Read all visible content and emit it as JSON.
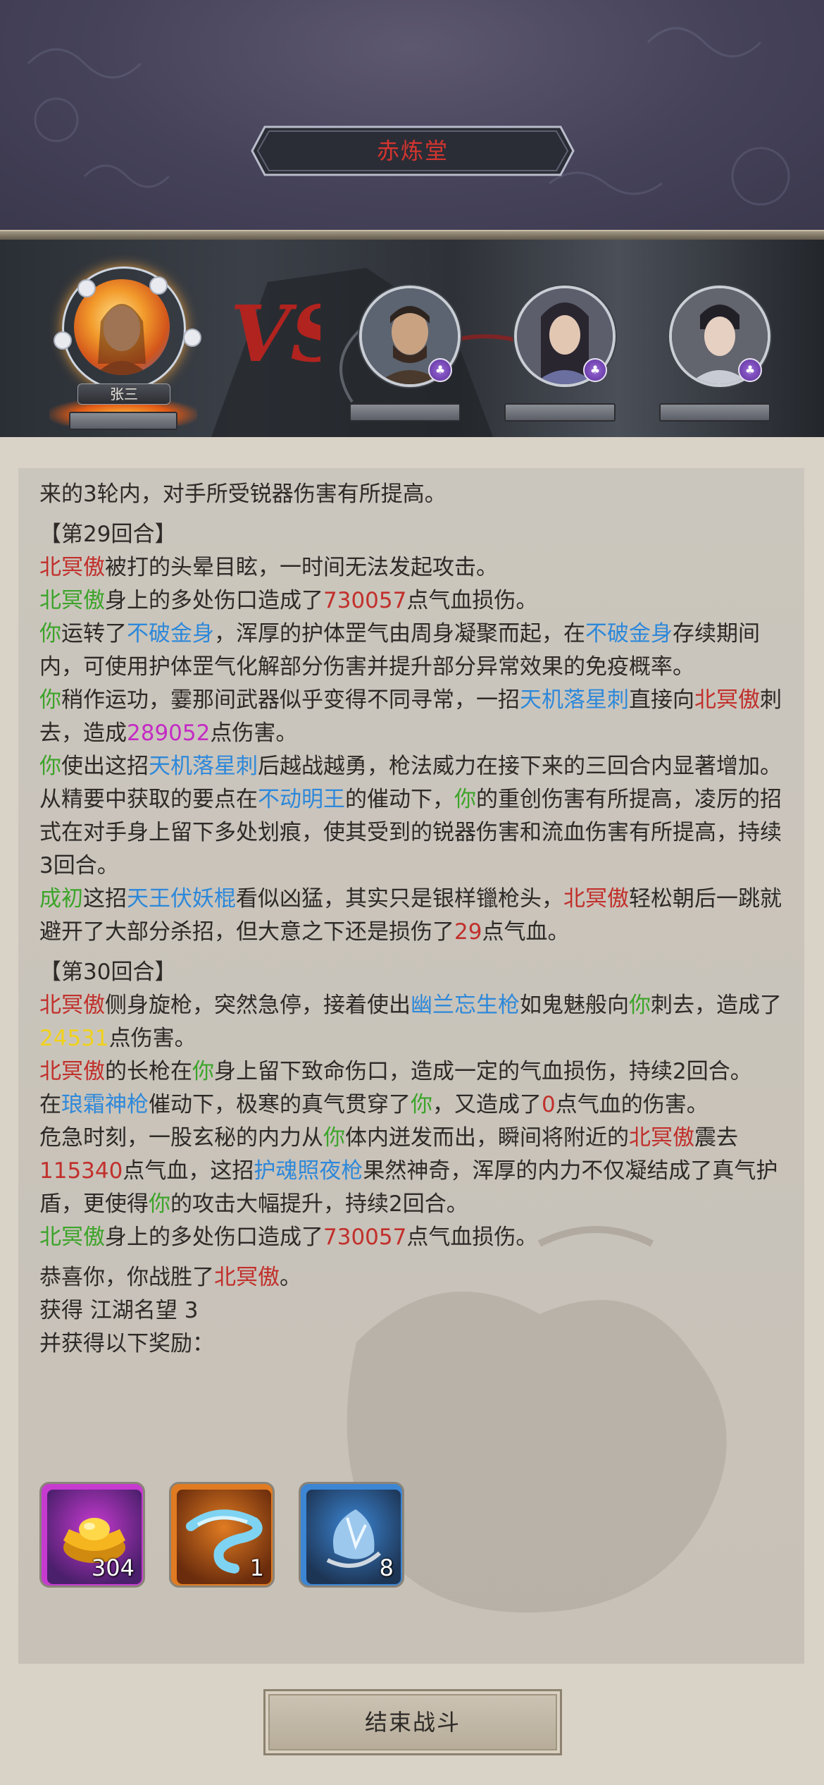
{
  "header": {
    "title": "赤炼堂"
  },
  "battle": {
    "player_name": "张三",
    "vs_label": "VS"
  },
  "colors": {
    "red": "#c1302c",
    "green": "#3ca42a",
    "blue": "#2d88da",
    "magenta": "#c42bc4",
    "yellow": "#f0d21b"
  },
  "log": [
    [
      [
        "n",
        "来的3轮内，对手所受锐器伤害有所提高。"
      ]
    ],
    [
      [
        "n",
        "【第29回合】"
      ]
    ],
    [
      [
        "r",
        "北冥傲"
      ],
      [
        "n",
        "被打的头晕目眩，一时间无法发起攻击。"
      ]
    ],
    [
      [
        "g",
        "北冥傲"
      ],
      [
        "n",
        "身上的多处伤口造成了"
      ],
      [
        "r",
        "730057"
      ],
      [
        "n",
        "点气血损伤。"
      ]
    ],
    [
      [
        "g",
        "你"
      ],
      [
        "n",
        "运转了"
      ],
      [
        "b",
        "不破金身"
      ],
      [
        "n",
        "，浑厚的护体罡气由周身凝聚而起，在"
      ],
      [
        "b",
        "不破金身"
      ],
      [
        "n",
        "存续期间内，可使用护体罡气化解部分伤害并提升部分异常效果的免疫概率。"
      ]
    ],
    [
      [
        "g",
        "你"
      ],
      [
        "n",
        "稍作运功，霎那间武器似乎变得不同寻常，一招"
      ],
      [
        "b",
        "天机落星刺"
      ],
      [
        "n",
        "直接向"
      ],
      [
        "r",
        "北冥傲"
      ],
      [
        "n",
        "刺去，造成"
      ],
      [
        "m",
        "289052"
      ],
      [
        "n",
        "点伤害。"
      ]
    ],
    [
      [
        "g",
        "你"
      ],
      [
        "n",
        "使出这招"
      ],
      [
        "b",
        "天机落星刺"
      ],
      [
        "n",
        "后越战越勇，枪法威力在接下来的三回合内显著增加。"
      ]
    ],
    [
      [
        "n",
        "从精要中获取的要点在"
      ],
      [
        "b",
        "不动明王"
      ],
      [
        "n",
        "的催动下，"
      ],
      [
        "g",
        "你"
      ],
      [
        "n",
        "的重创伤害有所提高，凌厉的招式在对手身上留下多处划痕，使其受到的锐器伤害和流血伤害有所提高，持续3回合。"
      ]
    ],
    [
      [
        "g",
        "成初"
      ],
      [
        "n",
        "这招"
      ],
      [
        "b",
        "天王伏妖棍"
      ],
      [
        "n",
        "看似凶猛，其实只是银样镴枪头，"
      ],
      [
        "r",
        "北冥傲"
      ],
      [
        "n",
        "轻松朝后一跳就避开了大部分杀招，但大意之下还是损伤了"
      ],
      [
        "r",
        "29"
      ],
      [
        "n",
        "点气血。"
      ]
    ],
    [
      [
        "n",
        "【第30回合】"
      ]
    ],
    [
      [
        "r",
        "北冥傲"
      ],
      [
        "n",
        "侧身旋枪，突然急停，接着使出"
      ],
      [
        "b",
        "幽兰忘生枪"
      ],
      [
        "n",
        "如鬼魅般向"
      ],
      [
        "g",
        "你"
      ],
      [
        "n",
        "刺去，造成了"
      ],
      [
        "y",
        "24531"
      ],
      [
        "n",
        "点伤害。"
      ]
    ],
    [
      [
        "r",
        "北冥傲"
      ],
      [
        "n",
        "的长枪在"
      ],
      [
        "g",
        "你"
      ],
      [
        "n",
        "身上留下致命伤口，造成一定的气血损伤，持续2回合。"
      ]
    ],
    [
      [
        "n",
        "在"
      ],
      [
        "b",
        "琅霜神枪"
      ],
      [
        "n",
        "催动下，极寒的真气贯穿了"
      ],
      [
        "g",
        "你"
      ],
      [
        "n",
        "，又造成了"
      ],
      [
        "r",
        "0"
      ],
      [
        "n",
        "点气血的伤害。"
      ]
    ],
    [
      [
        "n",
        "危急时刻，一股玄秘的内力从"
      ],
      [
        "g",
        "你"
      ],
      [
        "n",
        "体内迸发而出，瞬间将附近的"
      ],
      [
        "r",
        "北冥傲"
      ],
      [
        "n",
        "震去"
      ],
      [
        "r",
        "115340"
      ],
      [
        "n",
        "点气血，这招"
      ],
      [
        "b",
        "护魂照夜枪"
      ],
      [
        "n",
        "果然神奇，浑厚的内力不仅凝结成了真气护盾，更使得"
      ],
      [
        "g",
        "你"
      ],
      [
        "n",
        "的攻击大幅提升，持续2回合。"
      ]
    ],
    [
      [
        "g",
        "北冥傲"
      ],
      [
        "n",
        "身上的多处伤口造成了"
      ],
      [
        "r",
        "730057"
      ],
      [
        "n",
        "点气血损伤。"
      ]
    ],
    [
      [
        "n",
        "恭喜你，你战胜了"
      ],
      [
        "r",
        "北冥傲"
      ],
      [
        "n",
        "。"
      ]
    ],
    [
      [
        "n",
        "获得 江湖名望 3"
      ]
    ],
    [
      [
        "n",
        "并获得以下奖励："
      ]
    ]
  ],
  "rewards": [
    {
      "icon": "gold-ingot-icon",
      "count": "304",
      "frame": "#c63ad0",
      "bg": "#4a1f6b"
    },
    {
      "icon": "cloud-swirl-icon",
      "count": "1",
      "frame": "#e07b22",
      "bg": "#6a2c0c"
    },
    {
      "icon": "ice-crystal-icon",
      "count": "8",
      "frame": "#3c86d4",
      "bg": "#1d3555"
    }
  ],
  "end_button": "结束战斗"
}
